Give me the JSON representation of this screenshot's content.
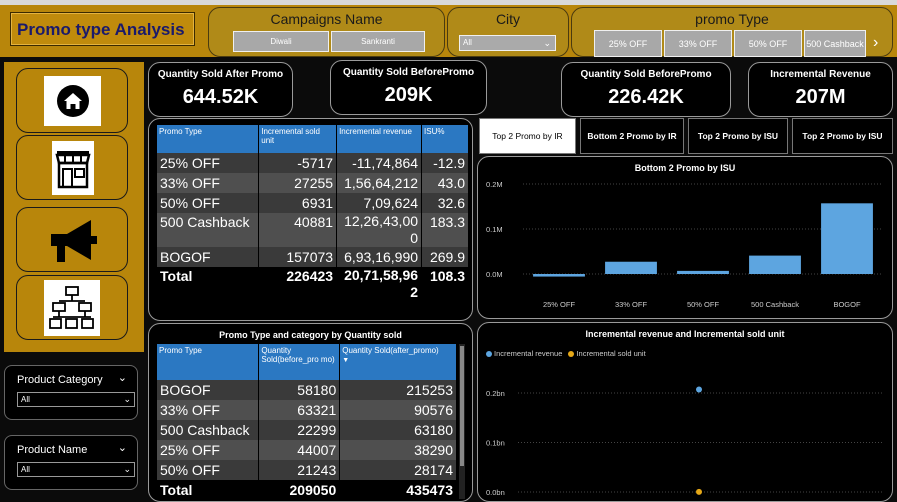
{
  "header": {
    "title": "Promo type  Analysis",
    "campaigns": {
      "title": "Campaigns Name",
      "options": [
        "Diwali",
        "Sankranti"
      ]
    },
    "city": {
      "title": "City",
      "selected": "All"
    },
    "promo_type": {
      "title": "promo Type",
      "options": [
        "25% OFF",
        "33% OFF",
        "50% OFF",
        "500 Cashback"
      ],
      "next": "›"
    }
  },
  "sidebar": {
    "nav": [
      "home-icon",
      "store-icon",
      "megaphone-icon",
      "hierarchy-icon"
    ],
    "filters": [
      {
        "title": "Product Category",
        "selected": "All"
      },
      {
        "title": "Product Name",
        "selected": "All"
      }
    ]
  },
  "kpis": [
    {
      "label": "Quantity Sold After Promo",
      "value": "644.52K"
    },
    {
      "label": "Quantity Sold BeforePromo",
      "value": "209K"
    },
    {
      "label": "Quantity Sold BeforePromo",
      "value": "226.42K"
    },
    {
      "label": "Incremental Revenue",
      "value": "207M"
    }
  ],
  "table1": {
    "headers": [
      "Promo Type",
      "Incremental sold unit",
      "Incremental revenue",
      "ISU%"
    ],
    "rows": [
      [
        "25% OFF",
        "-5717",
        "-11,74,864",
        "-12.9"
      ],
      [
        "33% OFF",
        "27255",
        "1,56,64,212",
        "43.0"
      ],
      [
        "50% OFF",
        "6931",
        "7,09,624",
        "32.6"
      ],
      [
        "500 Cashback",
        "40881",
        "12,26,43,00\n0",
        "183.3"
      ],
      [
        "BOGOF",
        "157073",
        "6,93,16,990",
        "269.9"
      ]
    ],
    "total": [
      "Total",
      "226423",
      "20,71,58,96\n2",
      "108.3"
    ]
  },
  "tabs": [
    "Top 2 Promo by IR",
    "Bottom 2 Promo by IR",
    "Top 2 Promo by ISU",
    "Top 2 Promo by ISU"
  ],
  "bar_chart": {
    "title": "Bottom 2 Promo by ISU",
    "yticks": [
      "0.2M",
      "0.1M",
      "0.0M"
    ]
  },
  "table2": {
    "title": "Promo Type and category by Quantity sold",
    "headers": [
      "Promo Type",
      "Quantity Sold(before_pro mo)",
      "Quantity Sold(after_promo)"
    ],
    "rows": [
      [
        "BOGOF",
        "58180",
        "215253"
      ],
      [
        "33% OFF",
        "63321",
        "90576"
      ],
      [
        "500 Cashback",
        "22299",
        "63180"
      ],
      [
        "25% OFF",
        "44007",
        "38290"
      ],
      [
        "50% OFF",
        "21243",
        "28174"
      ]
    ],
    "total": [
      "Total",
      "209050",
      "435473"
    ]
  },
  "scatter": {
    "title": "Incremental revenue and Incremental sold unit",
    "legend": [
      "Incremental revenue",
      "Incremental sold unit"
    ],
    "yticks": [
      "0.2bn",
      "0.1bn",
      "0.0bn"
    ]
  },
  "chart_data": [
    {
      "type": "bar",
      "title": "Bottom 2 Promo by ISU",
      "categories": [
        "25% OFF",
        "33% OFF",
        "50% OFF",
        "500 Cashback",
        "BOGOF"
      ],
      "values": [
        -5717,
        27255,
        6931,
        40881,
        157073
      ],
      "ylim": [
        -20000,
        220000
      ],
      "color": "#5da5e0"
    },
    {
      "type": "scatter",
      "title": "Incremental revenue and Incremental sold unit",
      "series": [
        {
          "name": "Incremental revenue",
          "color": "#5da5e0",
          "values": [
            207158962
          ]
        },
        {
          "name": "Incremental sold unit",
          "color": "#e6a817",
          "values": [
            226423
          ]
        }
      ],
      "ylim": [
        0,
        300000000
      ]
    }
  ],
  "colors": {
    "accent_gold": "#b8860b",
    "header_blue": "#2b78c2",
    "bar_blue": "#5da5e0",
    "point_gold": "#e6a817"
  }
}
